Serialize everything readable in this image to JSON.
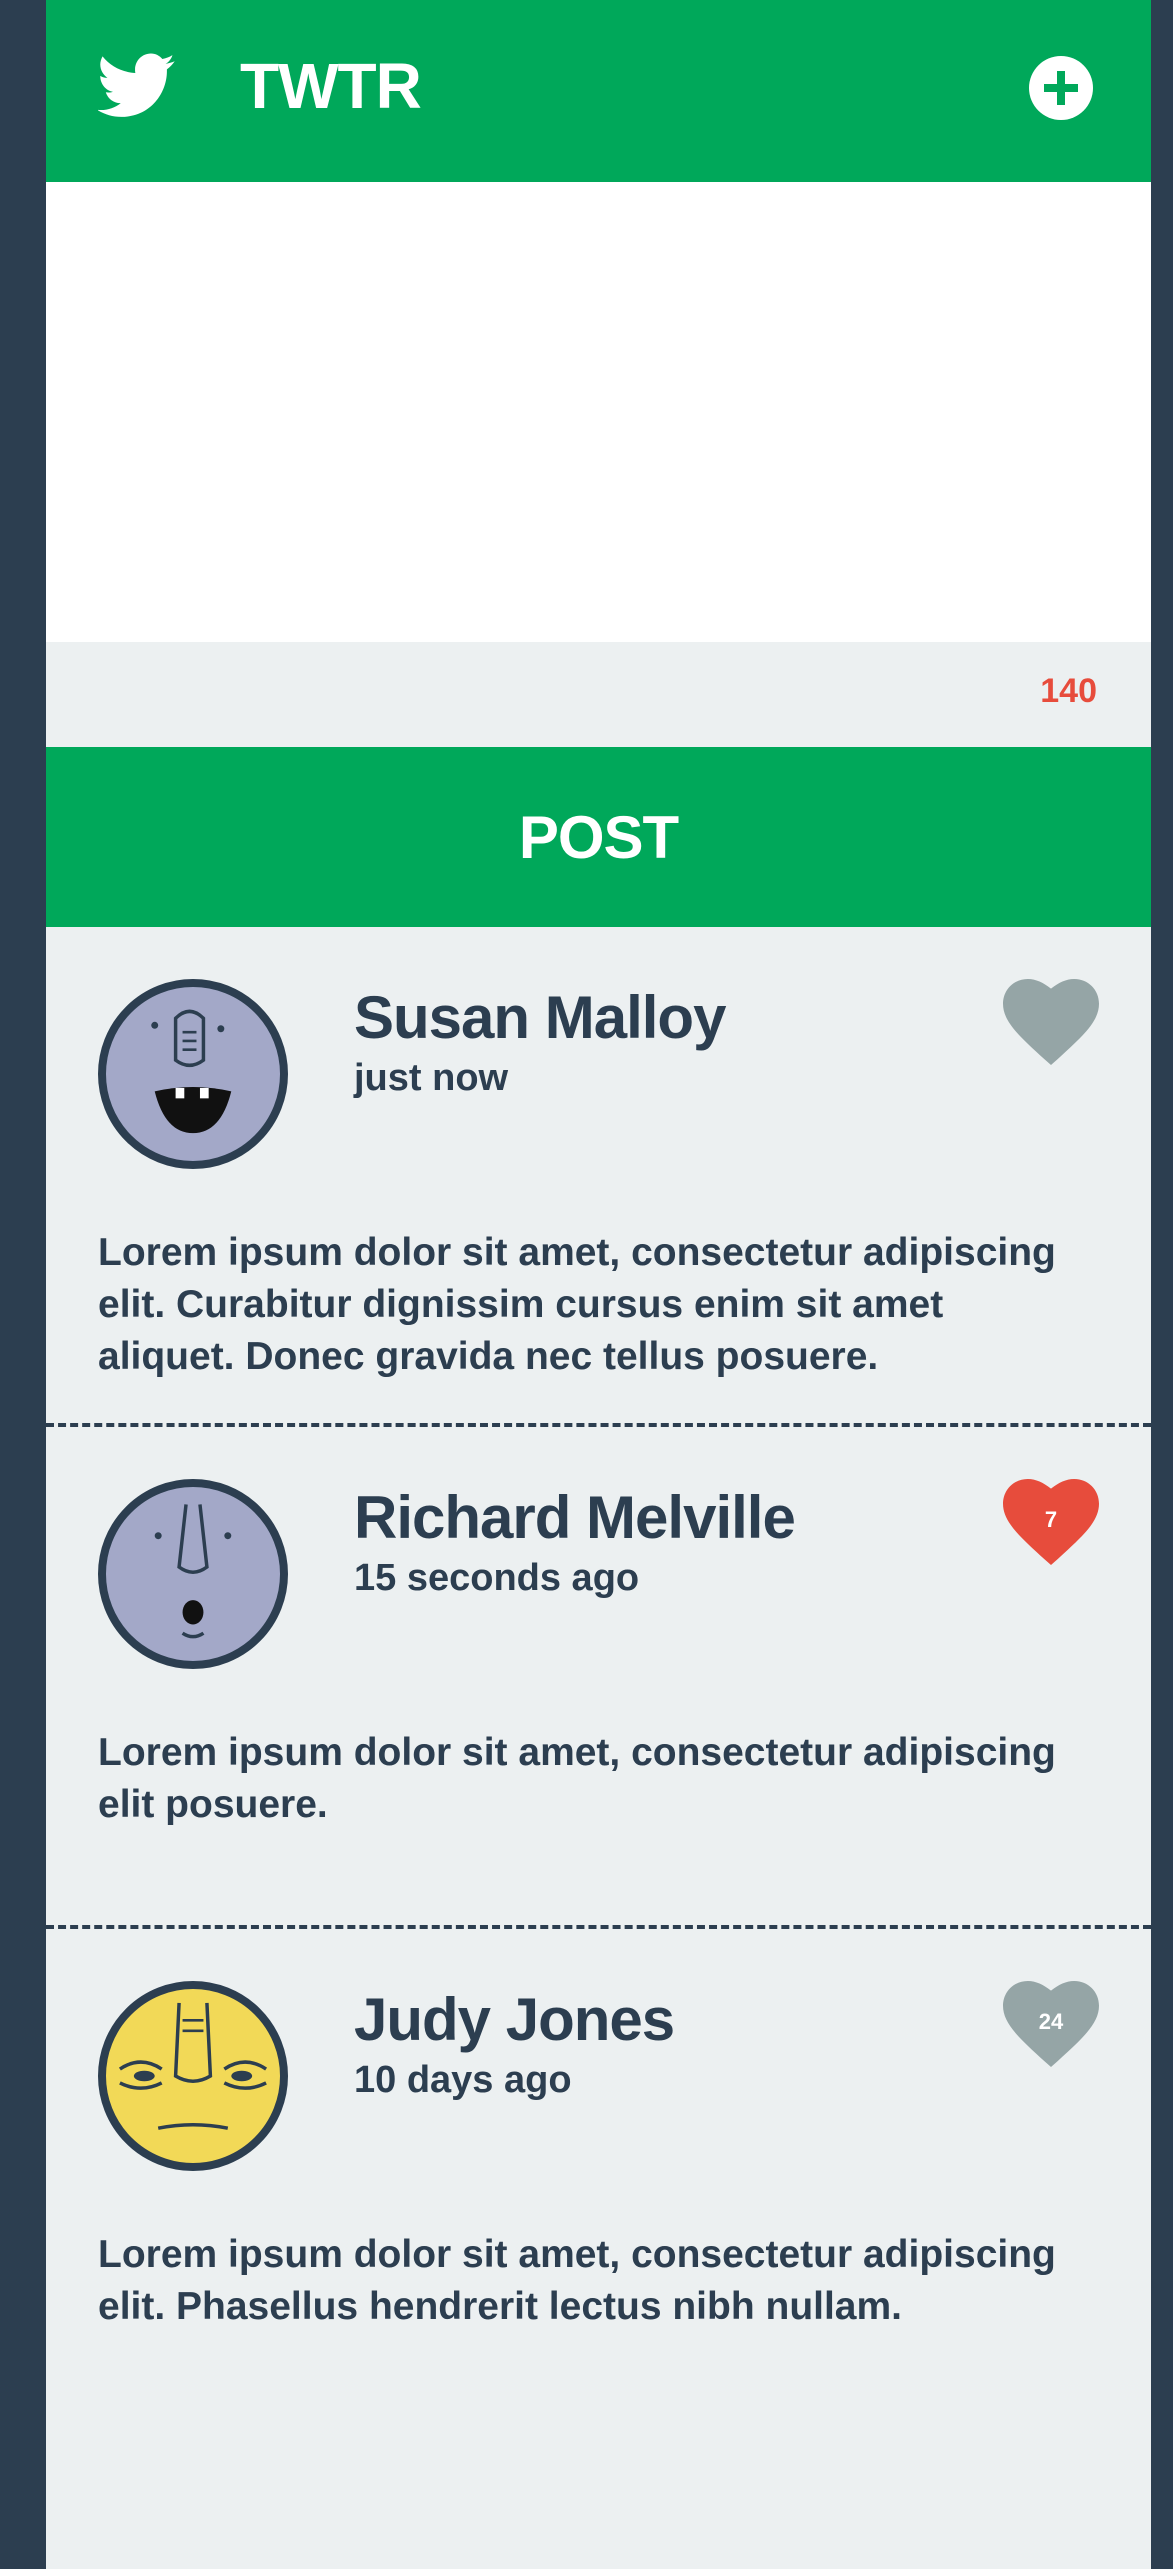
{
  "header": {
    "title": "TWTR",
    "logo_icon": "twitter-bird-icon",
    "add_icon": "plus-circle-icon"
  },
  "compose": {
    "value": "",
    "char_count": "140"
  },
  "post_button": {
    "label": "POST"
  },
  "colors": {
    "brand_green": "#00a85a",
    "dark_navy": "#2c3e50",
    "counter_red": "#e74c3c",
    "liked_red": "#e74c3c",
    "unliked_gray": "#95a5a6"
  },
  "tweets": [
    {
      "name": "Susan Malloy",
      "time": "just now",
      "text": "Lorem ipsum dolor sit amet, consectetur adipiscing elit. Curabitur dignissim cursus enim sit amet aliquet. Donec gravida nec tellus posuere.",
      "likes": "",
      "liked": false,
      "avatar": "purple-face-avatar"
    },
    {
      "name": "Richard Melville",
      "time": "15 seconds ago",
      "text": "Lorem ipsum dolor sit amet, consectetur adipiscing elit posuere.",
      "likes": "7",
      "liked": true,
      "avatar": "purple-face-avatar"
    },
    {
      "name": "Judy Jones",
      "time": "10 days ago",
      "text": "Lorem ipsum dolor sit amet, consectetur adipiscing elit. Phasellus hendrerit lectus nibh nullam.",
      "likes": "24",
      "liked": false,
      "avatar": "yellow-face-avatar"
    }
  ]
}
